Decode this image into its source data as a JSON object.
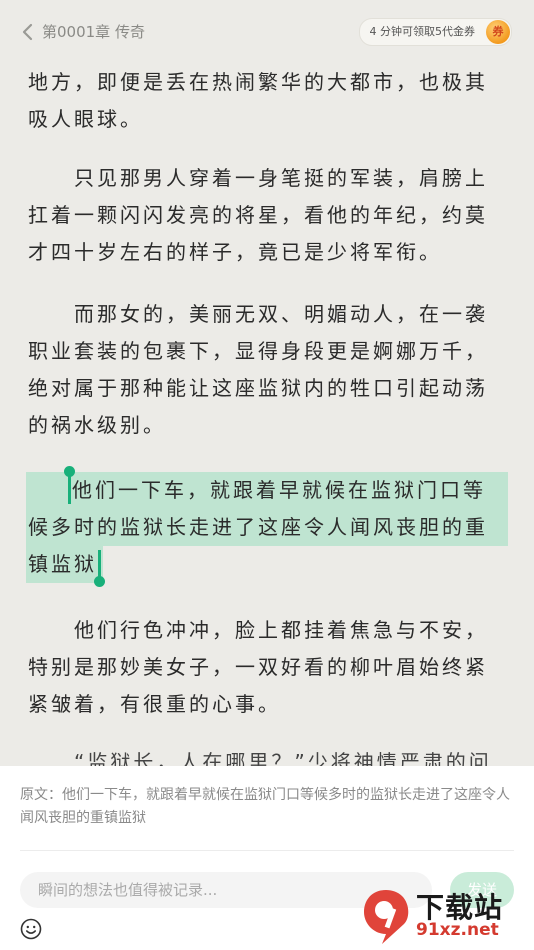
{
  "header": {
    "chapter_title": "第0001章 传奇",
    "coupon_label": "4 分钟可领取5代金券",
    "coupon_badge": "券"
  },
  "reader": {
    "p0": "地方，即便是丢在热闹繁华的大都市，也极其吸人眼球。",
    "p1": "只见那男人穿着一身笔挺的军装，肩膀上扛着一颗闪闪发亮的将星，看他的年纪，约莫才四十岁左右的样子，竟已是少将军衔。",
    "p2": "而那女的，美丽无双、明媚动人，在一袭职业套装的包裹下，显得身段更是婀娜万千，绝对属于那种能让这座监狱内的牲口引起动荡的祸水级别。",
    "highlight_lines": [
      "他们一下车，就跟着早就候在监狱门口等",
      "候多时的监狱长走进了这座令人闻风丧胆的重",
      "镇监狱"
    ],
    "p4": "他们行色冲冲，脸上都挂着焦急与不安，特别是那妙美女子，一双好看的柳叶眉始终紧紧皱着，有很重的心事。",
    "p5_partial": "“监狱长，人在哪里？”少将神情严肃的问"
  },
  "comment_panel": {
    "quote": "原文：他们一下车，就跟着早就候在监狱门口等候多时的监狱长走进了这座令人闻风丧胆的重镇监狱",
    "input_placeholder": "瞬间的想法也值得被记录...",
    "send_label": "发送"
  },
  "watermark": {
    "text": "下载站",
    "url": "91xz.net"
  },
  "colors": {
    "highlight": "#bfe4d1",
    "cursor": "#18b07a",
    "send_bg": "#c9ecd9"
  }
}
